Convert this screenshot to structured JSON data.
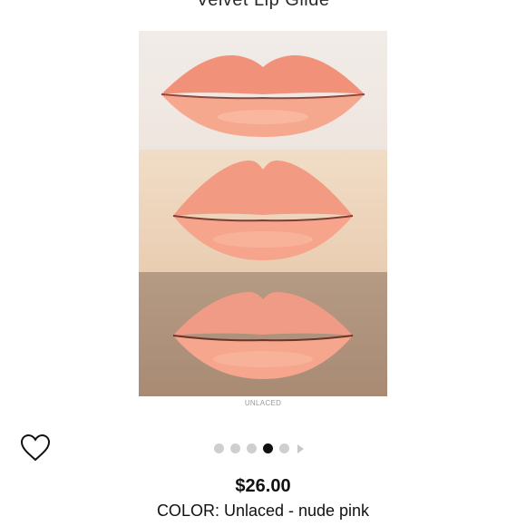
{
  "product": {
    "title": "Velvet Lip Glide",
    "shade_caption": "UNLACED",
    "price": "$26.00",
    "color_text": "COLOR: Unlaced - nude pink"
  },
  "carousel": {
    "slide_count": 5,
    "active_index": 3
  },
  "icons": {
    "favorite": "heart-outline-icon",
    "next": "chevron-right-icon"
  },
  "colors": {
    "lip_shade": "#f4a48c",
    "active_dot": "#111111",
    "inactive_dot": "#cfcfcf"
  }
}
